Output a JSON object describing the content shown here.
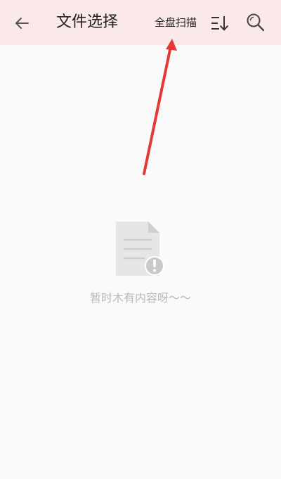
{
  "header": {
    "title": "文件选择",
    "scan_label": "全盘扫描",
    "back_icon": "arrow-left-icon",
    "sort_icon": "sort-descending-icon",
    "search_icon": "search-icon",
    "background_color": "#fbe8e8"
  },
  "empty_state": {
    "icon": "empty-file-warning-icon",
    "message": "暂时木有内容呀～～"
  },
  "annotation": {
    "type": "arrow",
    "color": "#e53935",
    "points_to": "全盘扫描"
  }
}
